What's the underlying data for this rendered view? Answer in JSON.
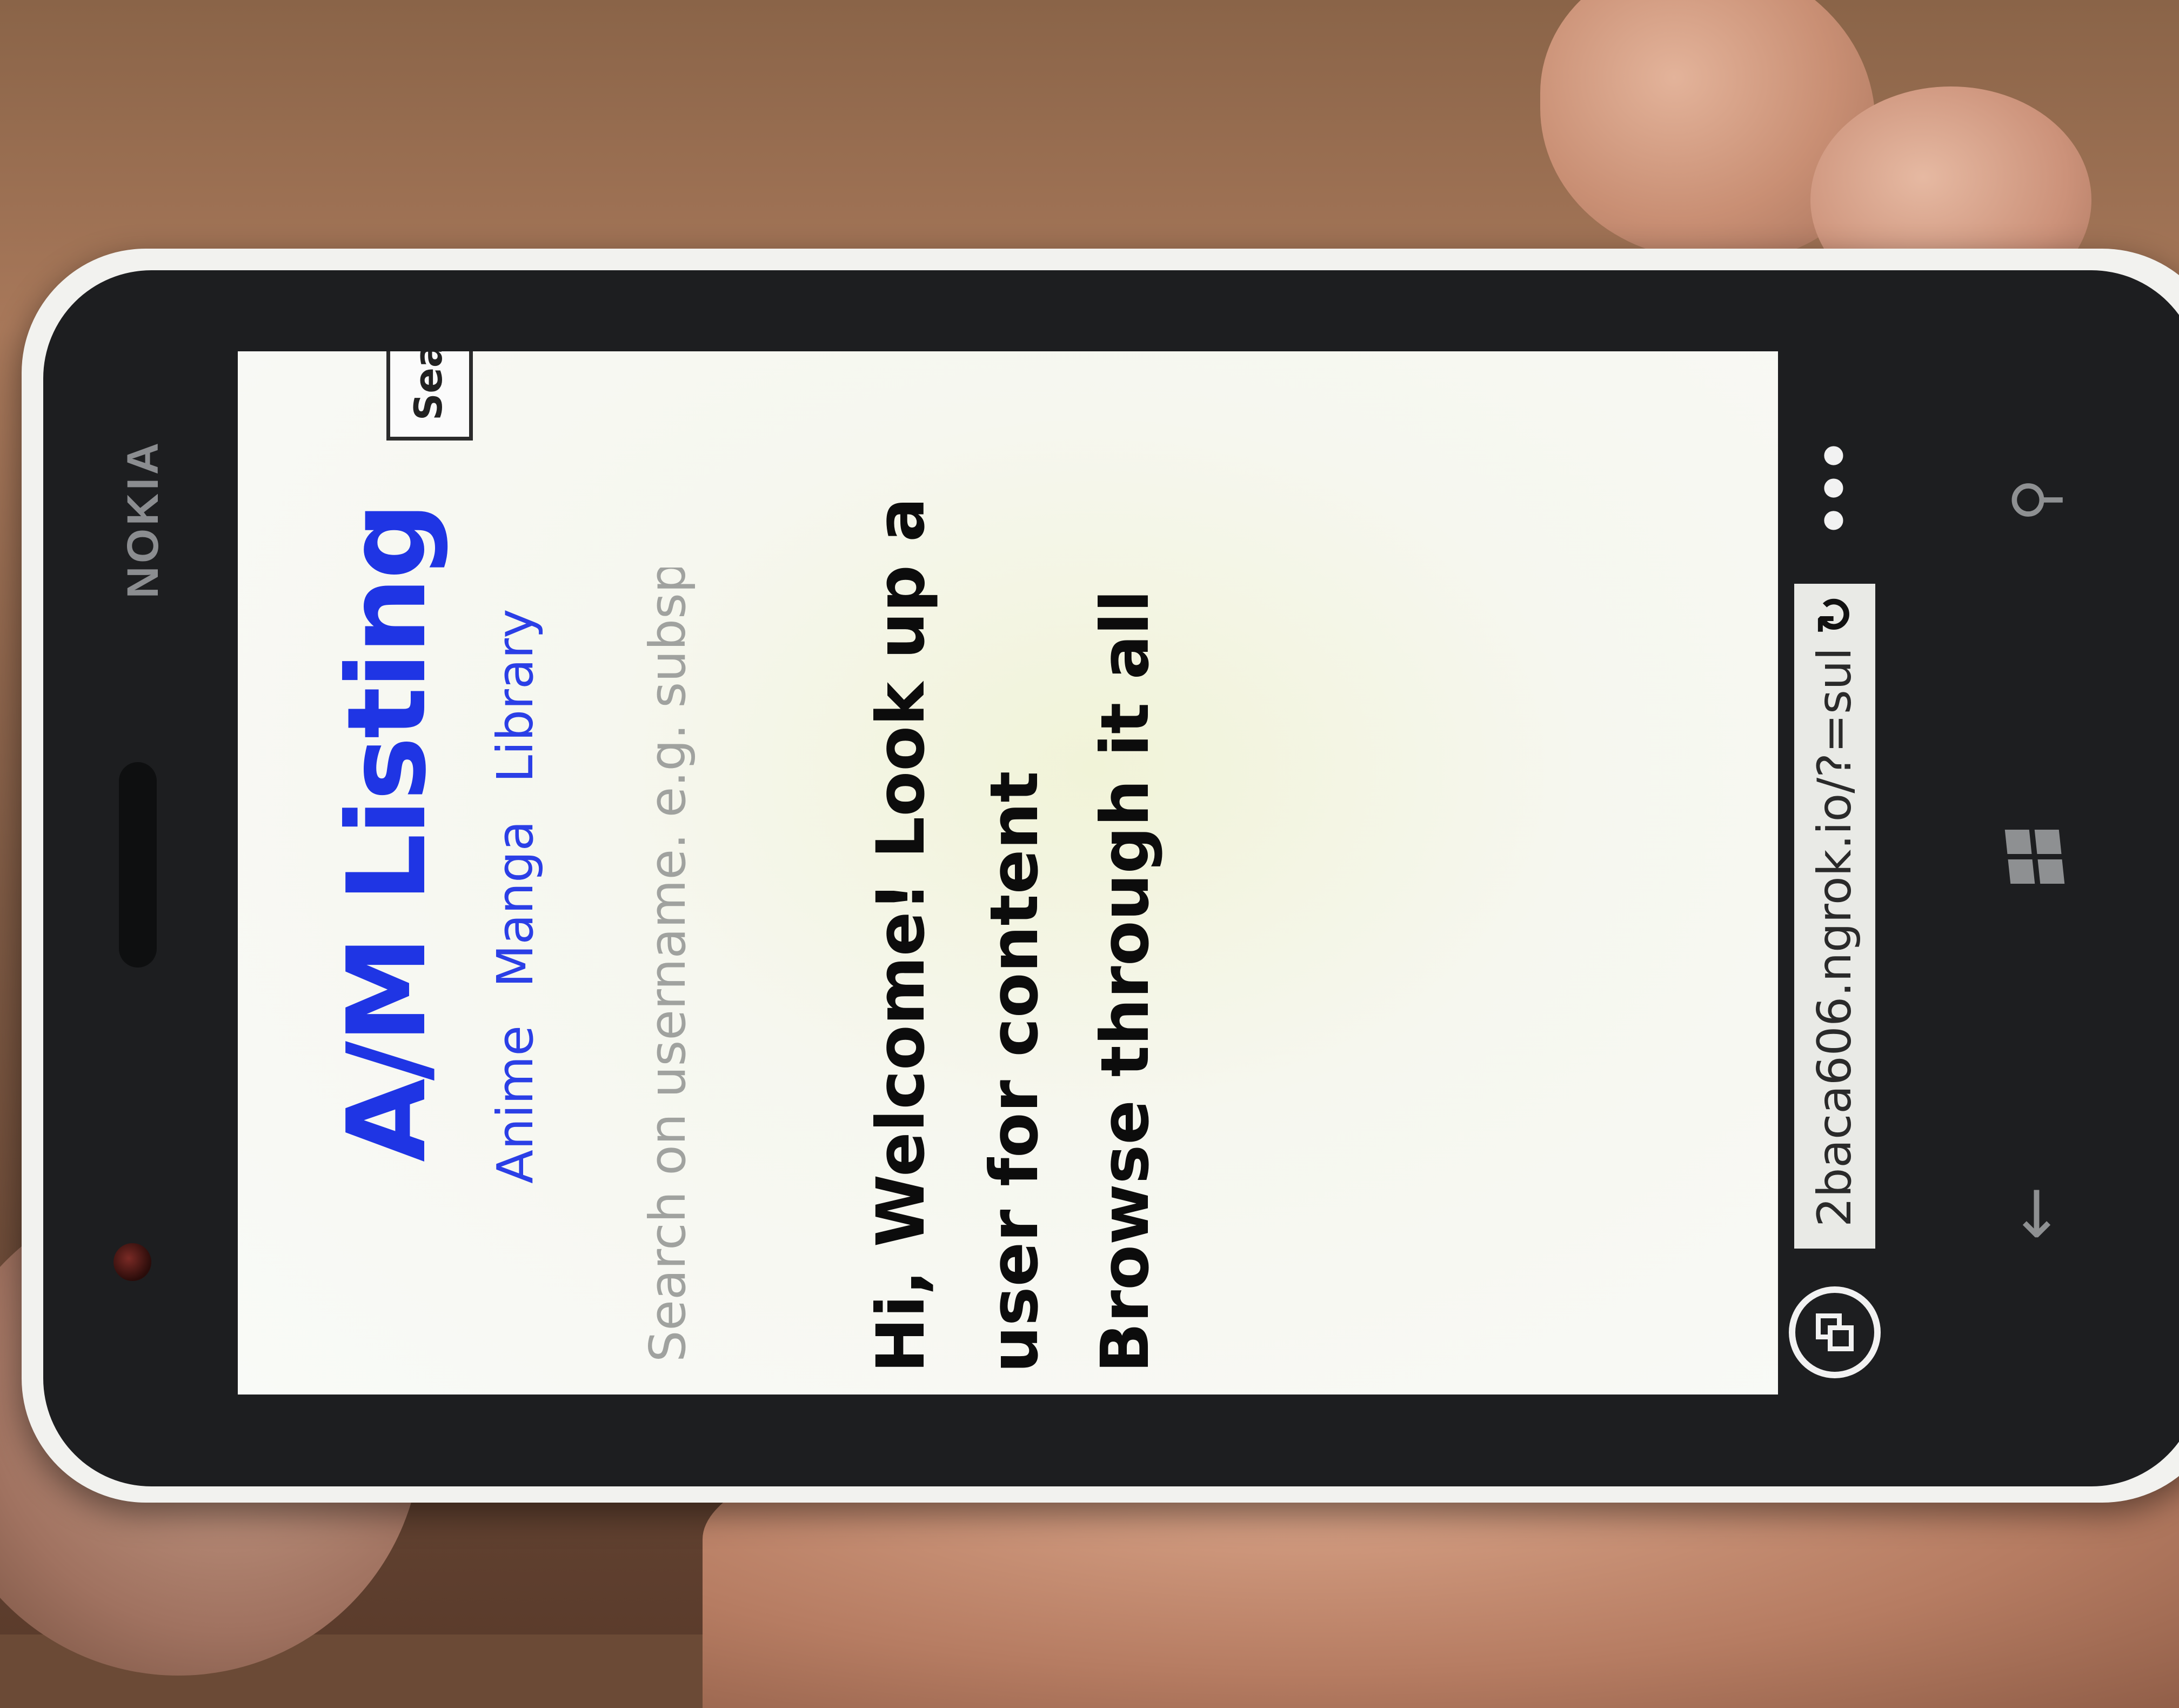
{
  "device": {
    "brand": "NOKIA"
  },
  "site": {
    "title": "A/M Listing",
    "nav": [
      "Anime",
      "Manga",
      "Library"
    ],
    "search": {
      "placeholder": "Search on username. e.g. subspa",
      "button_label": "Search"
    },
    "welcome": "Hi, Welcome! Look up a user for content",
    "browse": "Browse through it all"
  },
  "browser": {
    "url": "2baca606.ngrok.io/?=sul",
    "refresh_glyph": "↻",
    "more_glyph": "•••"
  },
  "hardware_buttons": {
    "search_glyph": "⚲",
    "back_glyph": "←"
  },
  "colors": {
    "link": "#2b3fe6",
    "title": "#1f35e4"
  }
}
